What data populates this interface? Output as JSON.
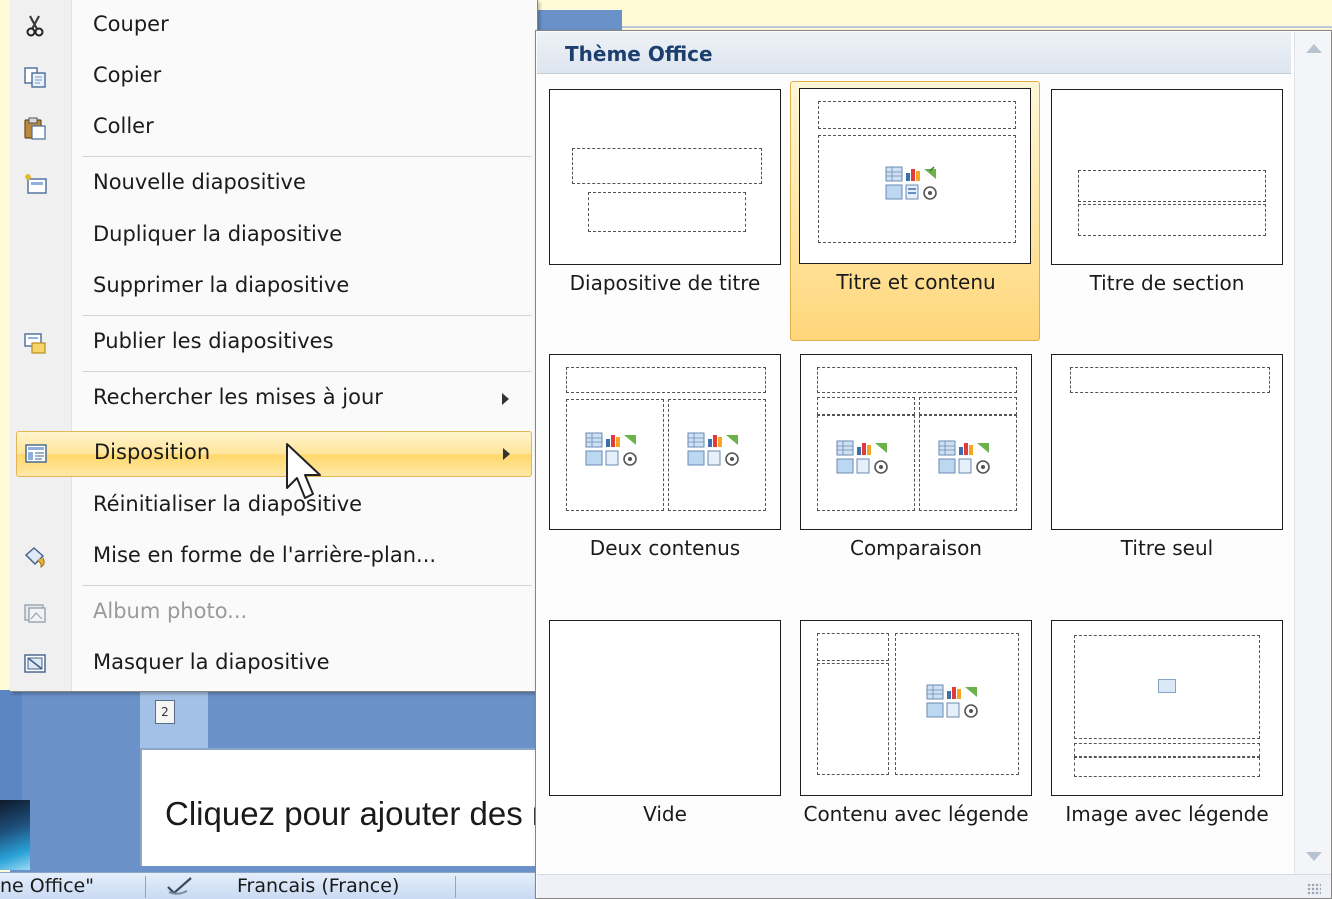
{
  "background": {
    "slide_number": "2",
    "slide_placeholder": "Cliquez pour ajouter des notes",
    "status_bar": {
      "theme": "ne Office\"",
      "language": "Francais (France)"
    }
  },
  "context_menu": {
    "items": [
      {
        "label": "Couper",
        "icon": "scissors-icon"
      },
      {
        "label": "Copier",
        "icon": "copy-icon"
      },
      {
        "label": "Coller",
        "icon": "paste-icon"
      },
      {
        "label": "Nouvelle diapositive",
        "icon": "new-slide-icon"
      },
      {
        "label": "Dupliquer la diapositive",
        "icon": ""
      },
      {
        "label": "Supprimer la diapositive",
        "icon": ""
      },
      {
        "label": "Publier les diapositives",
        "icon": "publish-slides-icon"
      },
      {
        "label": "Rechercher les mises à jour",
        "icon": "",
        "submenu": true
      },
      {
        "label": "Disposition",
        "icon": "layout-icon",
        "submenu": true,
        "highlighted": true
      },
      {
        "label": "Réinitialiser la diapositive",
        "icon": ""
      },
      {
        "label": "Mise en forme de l'arrière-plan...",
        "icon": "format-background-icon"
      },
      {
        "label": "Album photo...",
        "icon": "photo-album-icon",
        "disabled": true
      },
      {
        "label": "Masquer la diapositive",
        "icon": "hide-slide-icon"
      }
    ]
  },
  "layout_gallery": {
    "title": "Thème Office",
    "layouts": [
      {
        "label": "Diapositive de titre"
      },
      {
        "label": "Titre et contenu",
        "selected": true
      },
      {
        "label": "Titre de section"
      },
      {
        "label": "Deux contenus"
      },
      {
        "label": "Comparaison"
      },
      {
        "label": "Titre seul"
      },
      {
        "label": "Vide"
      },
      {
        "label": "Contenu avec légende"
      },
      {
        "label": "Image avec légende"
      }
    ]
  },
  "colors": {
    "highlight": "#ffe59a",
    "highlight_border": "#e3b654",
    "header_text": "#1d3f6e",
    "frame_blue": "#6a91c8"
  }
}
